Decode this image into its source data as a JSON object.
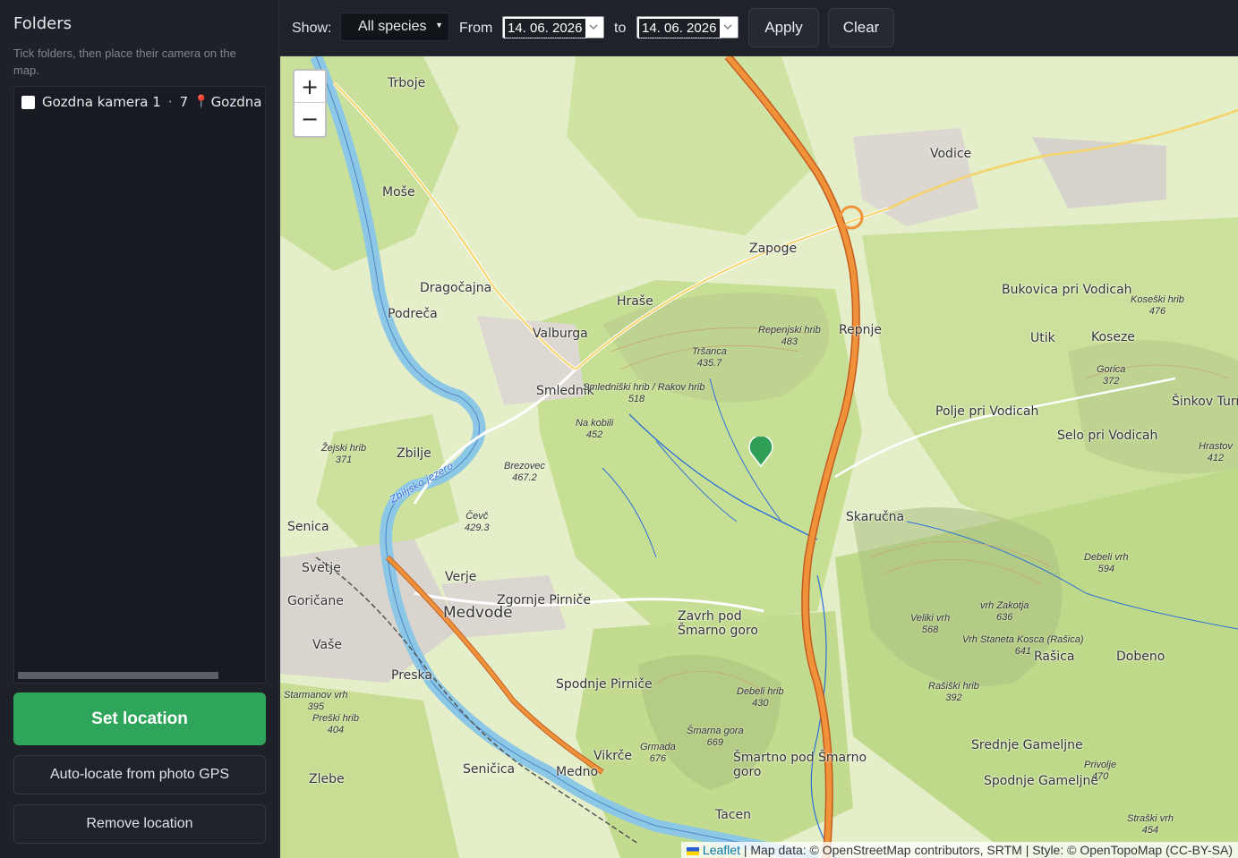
{
  "sidebar": {
    "title": "Folders",
    "hint": "Tick folders, then place their camera on the map.",
    "folders": [
      {
        "name": "Gozdna kamera 1",
        "count": "7",
        "location": "Gozdna k"
      }
    ],
    "set_location_label": "Set location",
    "auto_locate_label": "Auto-locate from photo GPS",
    "remove_location_label": "Remove location"
  },
  "toolbar": {
    "show_label": "Show:",
    "species_selected": "All species",
    "from_label": "From",
    "from_date": "14. 06. 2026",
    "to_label": "to",
    "to_date": "14. 06. 2026",
    "apply_label": "Apply",
    "clear_label": "Clear"
  },
  "map": {
    "zoom_in": "+",
    "zoom_out": "−",
    "attribution_link": "Leaflet",
    "attribution_text": " | Map data: © OpenStreetMap contributors, SRTM | Style: © OpenTopoMap (CC-BY-SA)",
    "places": [
      "Trboje",
      "Moše",
      "Dragočajna",
      "Podreča",
      "Valburga",
      "Hraše",
      "Zapoge",
      "Vodice",
      "Smlednik",
      "Zbilje",
      "Medvode",
      "Verje",
      "Zgornje Pirniče",
      "Zavrh pod Šmarno goro",
      "Spodnje Pirniče",
      "Preska",
      "Vaše",
      "Goričane",
      "Senica",
      "Svetje",
      "Repnje",
      "Skaručna",
      "Polje pri Vodicah",
      "Selo pri Vodicah",
      "Bukovica pri Vodicah",
      "Utik",
      "Koseze",
      "Šinkov Turn",
      "Rašica",
      "Dobeno",
      "Srednje Gameljne",
      "Spodnje Gameljne",
      "Šmartno pod Šmarno goro",
      "Tacen",
      "Vikrče",
      "Medno",
      "Seničica",
      "Zlebe",
      "Zbiljsko jezero"
    ],
    "peaks": [
      {
        "name": "Repenjski hrib",
        "elev": "483"
      },
      {
        "name": "Tršanca",
        "elev": "435.7"
      },
      {
        "name": "Smledniški hrib / Rakov hrib",
        "elev": "518"
      },
      {
        "name": "Na kobili",
        "elev": "452"
      },
      {
        "name": "Brezovec",
        "elev": "467.2"
      },
      {
        "name": "Čevč",
        "elev": "429.3"
      },
      {
        "name": "Žejski hrib",
        "elev": "371"
      },
      {
        "name": "Starmanov vrh",
        "elev": "395"
      },
      {
        "name": "Preški hrib",
        "elev": "404"
      },
      {
        "name": "Debeli hrib",
        "elev": "430"
      },
      {
        "name": "Šmarna gora",
        "elev": "669"
      },
      {
        "name": "Grmada",
        "elev": "676"
      },
      {
        "name": "Veliki vrh",
        "elev": "568"
      },
      {
        "name": "vrh Zakotja",
        "elev": "636"
      },
      {
        "name": "Vrh Staneta Kosca (Rašica)",
        "elev": "641"
      },
      {
        "name": "Rašiški hrib",
        "elev": "392"
      },
      {
        "name": "Debeli vrh",
        "elev": "594"
      },
      {
        "name": "Gorica",
        "elev": "372"
      },
      {
        "name": "Koseški hrib",
        "elev": "476"
      },
      {
        "name": "Hrastov",
        "elev": "412"
      },
      {
        "name": "Privolje",
        "elev": "470"
      },
      {
        "name": "Straški vrh",
        "elev": "454"
      }
    ]
  },
  "colors": {
    "accent_green": "#2ea55a",
    "marker": "#2f9e57",
    "motorway": "#f0923a"
  }
}
